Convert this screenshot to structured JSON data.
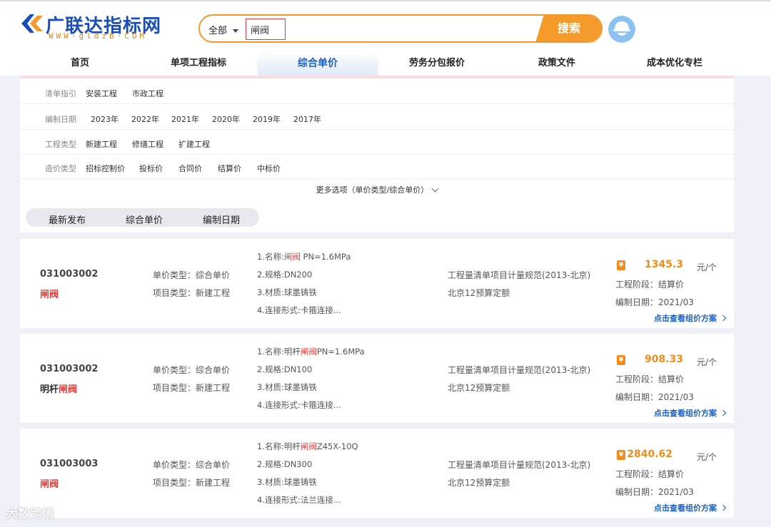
{
  "header": {
    "logo_text": "广联达指标网",
    "logo_sub": "WWW·gldzb·COM",
    "search_category": "全部",
    "search_value": "闸阀",
    "search_button": "搜索"
  },
  "nav": [
    "首页",
    "单项工程指标",
    "综合单价",
    "劳务分包报价",
    "政策文件",
    "成本优化专栏"
  ],
  "nav_active": "综合单价",
  "filters": [
    {
      "label": "清单指引",
      "options": [
        "安装工程",
        "市政工程"
      ]
    },
    {
      "label": "编制日期",
      "options": [
        "2023年",
        "2022年",
        "2021年",
        "2020年",
        "2019年",
        "2017年"
      ]
    },
    {
      "label": "工程类型",
      "options": [
        "新建工程",
        "修缮工程",
        "扩建工程"
      ]
    },
    {
      "label": "造价类型",
      "options": [
        "招标控制价",
        "投标价",
        "合同价",
        "结算价",
        "中标价"
      ]
    }
  ],
  "more_options": "更多选项（单价类型/综合单价）",
  "sort_tabs": [
    "最新发布",
    "综合单价",
    "编制日期"
  ],
  "labels": {
    "price_type": "单价类型：综合单价",
    "project_type": "项目类型：新建工程",
    "std1": "工程量清单项目计量规范(2013-北京)",
    "std2": "北京12预算定额",
    "stage": "工程阶段：结算价",
    "link": "点击查看组价方案"
  },
  "results": [
    {
      "code": "031003002",
      "name_pre": "",
      "name_hl": "闸阀",
      "spec1_pre": "1.名称:",
      "spec1_hl": "闸阀",
      "spec1_post": " PN=1.6MPa",
      "spec2": "2.规格:DN200",
      "spec3": "3.材质:球墨铸铁",
      "spec4": "4.连接形式:卡箍连接...",
      "price": "1345.3",
      "unit": "元/个",
      "date": "编制日期：2021/03"
    },
    {
      "code": "031003002",
      "name_pre": "明杆",
      "name_hl": "闸阀",
      "spec1_pre": "1.名称:明杆",
      "spec1_hl": "闸阀",
      "spec1_post": "PN=1.6MPa",
      "spec2": "2.规格:DN100",
      "spec3": "3.材质:球墨铸铁",
      "spec4": "4.连接形式:卡箍连接...",
      "price": "908.33",
      "unit": "元/个",
      "date": "编制日期：2021/03"
    },
    {
      "code": "031003003",
      "name_pre": "",
      "name_hl": "闸阀",
      "spec1_pre": "1.名称:明杆",
      "spec1_hl": "闸阀",
      "spec1_post": "Z45X-10Q",
      "spec2": "2.规格:DN300",
      "spec3": "3.材质:球墨铸铁",
      "spec4": "4.连接形式:法兰连接...",
      "price": "2840.62",
      "unit": "元/个",
      "date": "编制日期：2021/03"
    }
  ],
  "watermark": "大数跨境",
  "colors": {
    "accent": "#f39a2b",
    "brand_blue": "#1a4fb5",
    "highlight": "#e53935",
    "link": "#1a5fc4"
  },
  "icons": [
    "logo-mark-icon",
    "caret-down-icon",
    "user-avatar-icon",
    "chevron-down-icon",
    "yuan-icon",
    "chevron-right-icon"
  ]
}
